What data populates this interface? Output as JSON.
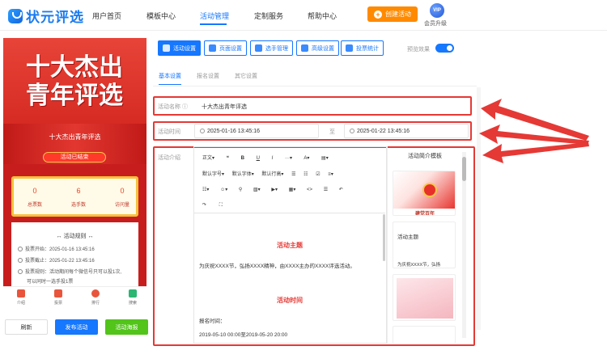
{
  "app": {
    "logo": "状元评选"
  },
  "nav": {
    "items": [
      {
        "label": "用户首页"
      },
      {
        "label": "模板中心"
      },
      {
        "label": "活动管理"
      },
      {
        "label": "定制服务"
      },
      {
        "label": "帮助中心"
      }
    ],
    "active_index": 2,
    "create_button": "创建活动",
    "vip_badge": "VIP",
    "vip_label": "会员升级"
  },
  "preview": {
    "poster_line1": "十大杰出",
    "poster_line2": "青年评选",
    "activity_name": "十大杰出青年评选",
    "status": "活动已结束",
    "stats": [
      {
        "value": "0",
        "label": "总票数"
      },
      {
        "value": "6",
        "label": "选手数"
      },
      {
        "value": "0",
        "label": "访问量"
      }
    ],
    "rules_title": "活动规则",
    "rules": [
      "投票开始：2025-01-16 13:45:16",
      "投票截止：2025-01-22 13:45:16",
      "投票规则：活动期间每个微信号只可以投1次,",
      "可以同时一选手投1票"
    ],
    "tabbar": [
      {
        "label": "介绍",
        "color": "#e8553c"
      },
      {
        "label": "投票",
        "color": "#e8553c"
      },
      {
        "label": "排行",
        "color": "#e8553c"
      },
      {
        "label": "搜索",
        "color": "#2bb673"
      }
    ]
  },
  "actions": {
    "refresh": "刷新",
    "publish": "发布活动",
    "poster": "活动海报"
  },
  "toolbar": {
    "buttons": [
      "活动设置",
      "页面设置",
      "选手管理",
      "高级设置",
      "投票统计"
    ],
    "active_index": 0,
    "preview_effect": "预览效果"
  },
  "subtabs": {
    "items": [
      "基本设置",
      "报名设置",
      "其它设置"
    ],
    "active_index": 0
  },
  "form": {
    "name_label": "活动名称",
    "name_value": "十大杰出青年评选",
    "time_label": "活动时间",
    "start_time": "2025-01-16 13:45:16",
    "to": "至",
    "end_time": "2025-01-22 13:45:16",
    "intro_label": "活动介绍"
  },
  "editor": {
    "row1": [
      "正文",
      "❝",
      "B",
      "U",
      "I",
      "···",
      "A",
      "▤"
    ],
    "row2": [
      "默认字号",
      "默认字体",
      "默认行高",
      "☰",
      "☷",
      "☑",
      "≡"
    ],
    "row3": [
      "☷",
      "☺",
      "⚲",
      "▧",
      "▶",
      "▦",
      "<>",
      "☰",
      "↶"
    ],
    "row4": [
      "↷",
      "⛶"
    ],
    "h1": "活动主题",
    "p1": "为庆祝XXXX节，弘扬XXXX精神，由XXXX主办的XXXX评选活动。",
    "h2": "活动时间",
    "p2": "报名时间：",
    "p3": "2019-05-10 00:00至2019-05-20 20:00"
  },
  "templates": {
    "title": "活动简介模板",
    "items": [
      "建党百年",
      "活动主题",
      "为庆祝XXXX节，弘扬"
    ]
  },
  "colors": {
    "accent": "#1677ff",
    "orange": "#ff8a00",
    "red": "#e53935",
    "green": "#52c41a"
  }
}
